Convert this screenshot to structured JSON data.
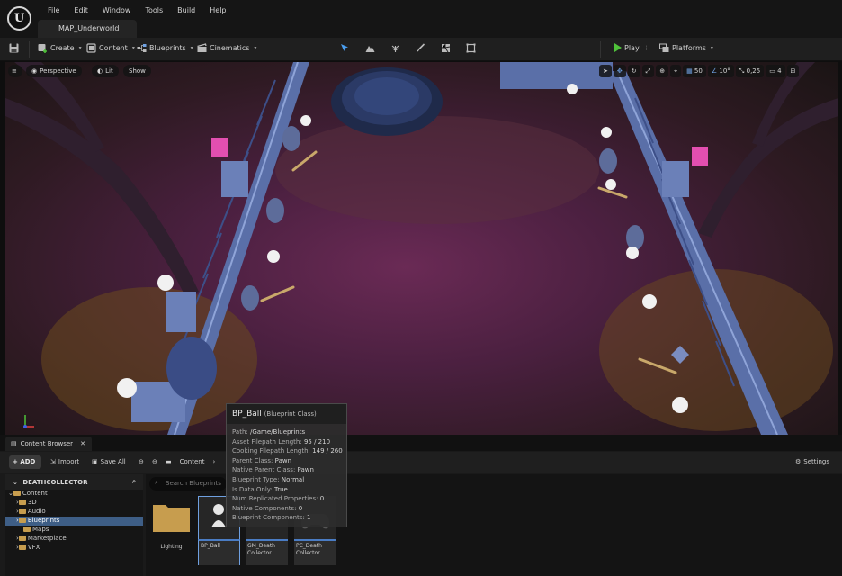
{
  "menu": [
    "File",
    "Edit",
    "Window",
    "Tools",
    "Build",
    "Help"
  ],
  "map_tab": "MAP_Underworld",
  "toolbar": {
    "create": "Create",
    "content": "Content",
    "blueprints": "Blueprints",
    "cinematics": "Cinematics",
    "play": "Play",
    "platforms": "Platforms"
  },
  "viewport": {
    "perspective": "Perspective",
    "lit": "Lit",
    "show": "Show",
    "grid_snap": "50",
    "rotation_snap": "10°",
    "scale_snap": "0,25",
    "camera_speed": "4"
  },
  "content_browser": {
    "tab_label": "Content Browser",
    "add": "ADD",
    "import": "Import",
    "save_all": "Save All",
    "path_root": "Content",
    "settings": "Settings",
    "search_placeholder": "Search Blueprints",
    "tree_title": "DEATHCOLLECTOR",
    "tree": [
      "Content",
      "3D",
      "Audio",
      "Blueprints",
      "Maps",
      "Marketplace",
      "VFX"
    ],
    "assets": [
      {
        "name": "Lighting"
      },
      {
        "name": "BP_Ball"
      },
      {
        "name": "GM_Death Collector"
      },
      {
        "name": "PC_Death Collector"
      }
    ]
  },
  "tooltip": {
    "title": "BP_Ball",
    "subtitle": "(Blueprint Class)",
    "rows": [
      {
        "label": "Path:",
        "value": "/Game/Blueprints"
      },
      {
        "label": "Asset Filepath Length:",
        "value": "95 / 210"
      },
      {
        "label": "Cooking Filepath Length:",
        "value": "149 / 260"
      },
      {
        "label": "Parent Class:",
        "value": "Pawn"
      },
      {
        "label": "Native Parent Class:",
        "value": "Pawn"
      },
      {
        "label": "Blueprint Type:",
        "value": "Normal"
      },
      {
        "label": "Is Data Only:",
        "value": "True"
      },
      {
        "label": "Num Replicated Properties:",
        "value": "0"
      },
      {
        "label": "Native Components:",
        "value": "0"
      },
      {
        "label": "Blueprint Components:",
        "value": "1"
      }
    ]
  },
  "colors": {
    "accent": "#4a7cc4",
    "play": "#4fc23a",
    "folder": "#c79d4e",
    "selection": "#3e5e86"
  }
}
